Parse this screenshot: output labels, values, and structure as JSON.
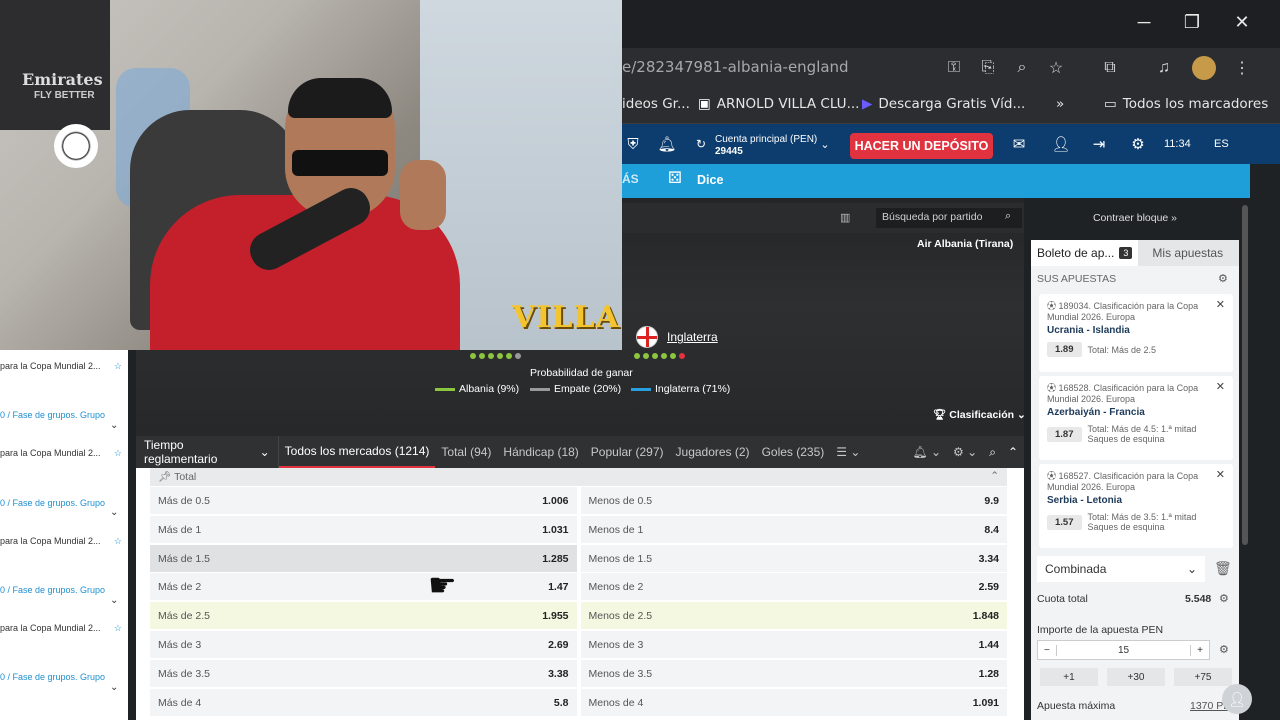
{
  "window_controls": {
    "minimize": "─",
    "restore": "❐",
    "close": "✕"
  },
  "address": {
    "url_fragment": "e/282347981-albania-england"
  },
  "bookmarks": [
    {
      "label": "ideos Gr..."
    },
    {
      "label": "ARNOLD VILLA CLU..."
    },
    {
      "label": "Descarga Gratis Víd..."
    },
    {
      "label": "»"
    },
    {
      "label": "Todos los marcadores"
    }
  ],
  "site_header": {
    "account_label": "Cuenta principal (PEN)",
    "account_balance": "29445",
    "deposit_label": "HACER UN DEPÓSITO",
    "time": "11:34",
    "lang": "ES"
  },
  "site_nav": {
    "items": [
      {
        "label": "ÁS"
      },
      {
        "label": "Dice"
      }
    ]
  },
  "match": {
    "search_placeholder": "Búsqueda por partido",
    "venue": "Air Albania (Tirana)",
    "team_away": "Inglaterra",
    "prob_title": "Probabilidad de ganar",
    "probs": [
      {
        "label": "Albania (9%)",
        "color": "#8cc63f"
      },
      {
        "label": "Empate (20%)",
        "color": "#9a9a9a"
      },
      {
        "label": "Inglaterra (71%)",
        "color": "#2a9fe0"
      }
    ],
    "clasificacion": "Clasificación"
  },
  "tabs": {
    "time_label": "Tiempo reglamentario",
    "items": [
      {
        "label": "Todos los mercados (1214)"
      },
      {
        "label": "Total (94)"
      },
      {
        "label": "Hándicap (18)"
      },
      {
        "label": "Popular (297)"
      },
      {
        "label": "Jugadores (2)"
      },
      {
        "label": "Goles (235)"
      }
    ]
  },
  "odds": {
    "section_label": "Total",
    "rows": [
      {
        "over": "Más de 0.5",
        "over_odd": "1.006",
        "under": "Menos de 0.5",
        "under_odd": "9.9"
      },
      {
        "over": "Más de 1",
        "over_odd": "1.031",
        "under": "Menos de 1",
        "under_odd": "8.4"
      },
      {
        "over": "Más de 1.5",
        "over_odd": "1.285",
        "under": "Menos de 1.5",
        "under_odd": "3.34"
      },
      {
        "over": "Más de 2",
        "over_odd": "1.47",
        "under": "Menos de 2",
        "under_odd": "2.59"
      },
      {
        "over": "Más de 2.5",
        "over_odd": "1.955",
        "under": "Menos de 2.5",
        "under_odd": "1.848"
      },
      {
        "over": "Más de 3",
        "over_odd": "2.69",
        "under": "Menos de 3",
        "under_odd": "1.44"
      },
      {
        "over": "Más de 3.5",
        "over_odd": "3.38",
        "under": "Menos de 3.5",
        "under_odd": "1.28"
      },
      {
        "over": "Más de 4",
        "over_odd": "5.8",
        "under": "Menos de 4",
        "under_odd": "1.091"
      }
    ]
  },
  "slip": {
    "contraer": "Contraer bloque »",
    "tab_bets": "Boleto de ap...",
    "count": "3",
    "tab_mine": "Mis apuestas",
    "heading": "SUS APUESTAS",
    "bets": [
      {
        "league": "189034. Clasificación para la Copa Mundial 2026. Europa",
        "teams": "Ucrania - Islandia",
        "odd": "1.89",
        "market": "Total: Más de 2.5"
      },
      {
        "league": "168528. Clasificación para la Copa Mundial 2026. Europa",
        "teams": "Azerbaiyán - Francia",
        "odd": "1.87",
        "market": "Total: Más de 4.5: 1.ª mitad Saques de esquina"
      },
      {
        "league": "168527. Clasificación para la Copa Mundial 2026. Europa",
        "teams": "Serbia - Letonia",
        "odd": "1.57",
        "market": "Total: Más de 3.5: 1.ª mitad Saques de esquina"
      }
    ],
    "combo": "Combinada",
    "cuota_label": "Cuota total",
    "cuota_value": "5.548",
    "stake_label": "Importe de la apuesta PEN",
    "stake_value": "15",
    "quick": [
      "+1",
      "+30",
      "+75"
    ],
    "max_label": "Apuesta máxima",
    "max_value": "1370 PE"
  },
  "left_sidebar": [
    {
      "title": "para la Copa Mundial 2...",
      "sub": "0 / Fase de grupos. Grupo"
    },
    {
      "title": "para la Copa Mundial 2...",
      "sub": "0 / Fase de grupos. Grupo"
    },
    {
      "title": "para la Copa Mundial 2...",
      "sub": "0 / Fase de grupos. Grupo"
    },
    {
      "title": "para la Copa Mundial 2...",
      "sub": "0 / Fase de grupos. Grupo"
    }
  ],
  "overlay": {
    "villa": "VILLA",
    "emirates": "Emirates",
    "flybetter": "FLY BETTER"
  }
}
